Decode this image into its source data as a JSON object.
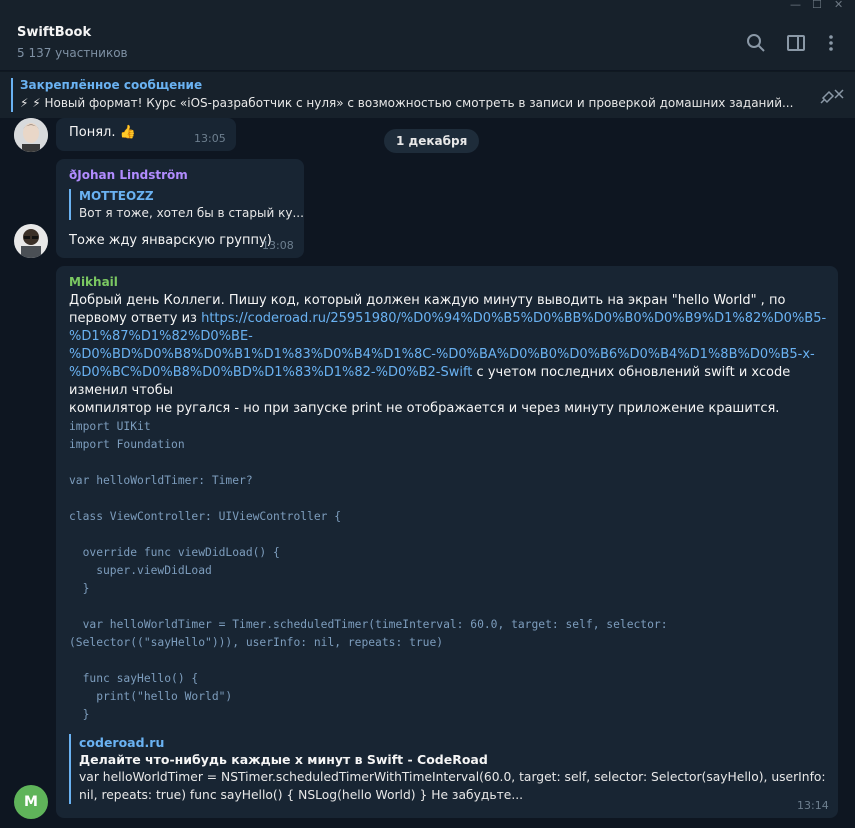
{
  "window": {
    "controls": [
      "—",
      "☐",
      "✕"
    ]
  },
  "header": {
    "title": "SwiftBook",
    "subtitle": "5 137 участников",
    "icons": [
      "search-icon",
      "sidebar-panel-icon",
      "more-vertical-icon"
    ]
  },
  "pinned": {
    "title": "Закреплённое сообщение",
    "text": "⚡ ⚡ Новый формат! Курс «iOS-разработчик с нуля» с возможностью смотреть в записи и проверкой домашних заданий..."
  },
  "date_chip": "1 декабря",
  "messages": [
    {
      "text": "Понял. 👍",
      "time": "13:05"
    },
    {
      "sender": "ðJohan Lindström",
      "sender_color": "#b18cff",
      "reply_name": "MOTTEOZZ",
      "reply_text": "Вот я тоже, хотел бы в старый ку...",
      "text": "Тоже жду январскую группу)",
      "time": "13:08"
    },
    {
      "sender": "Mikhail",
      "sender_color": "#7bc862",
      "avatar_letter": "M",
      "avatar_color": "#5fb45a",
      "text_before": "Добрый день Коллеги.  Пишу код, который должен каждую минуту выводить на экран \"hello World\" , по первому ответу из ",
      "link_line1": "https://coderoad.ru/25951980/%D0%94%D0%B5%D0%BB%D0%B0%D0%B9%D1%82%D0%B5-%D1%87%D1%82%D0%BE-",
      "link_line2": "%D0%BD%D0%B8%D0%B1%D1%83%D0%B4%D1%8C-%D0%BA%D0%B0%D0%B6%D0%B4%D1%8B%D0%B5-x-",
      "link_line3": "%D0%BC%D0%B8%D0%BD%D1%83%D1%82-%D0%B2-Swift",
      "text_after_link": "  с учетом последних обновлений swift и xcode изменил чтобы",
      "text_last": "компилятор не ругался - но при запуске print не отображается и через минуту приложение крашится.",
      "code": "import UIKit\nimport Foundation\n\nvar helloWorldTimer: Timer?\n\nclass ViewController: UIViewController {\n\n  override func viewDidLoad() {\n    super.viewDidLoad\n  }\n\n  var helloWorldTimer = Timer.scheduledTimer(timeInterval: 60.0, target: self, selector:\n(Selector((\"sayHello\"))), userInfo: nil, repeats: true)\n\n  func sayHello() {\n    print(\"hello World\")\n  }",
      "preview": {
        "site": "coderoad.ru",
        "title": "Делайте что-нибудь каждые x минут в Swift  - CodeRoad",
        "desc": "var helloWorldTimer = NSTimer.scheduledTimerWithTimeInterval(60.0, target: self, selector: Selector(sayHello), userInfo: nil, repeats: true) func sayHello() { NSLog(hello World) } Не забудьте..."
      },
      "time": "13:14"
    }
  ]
}
